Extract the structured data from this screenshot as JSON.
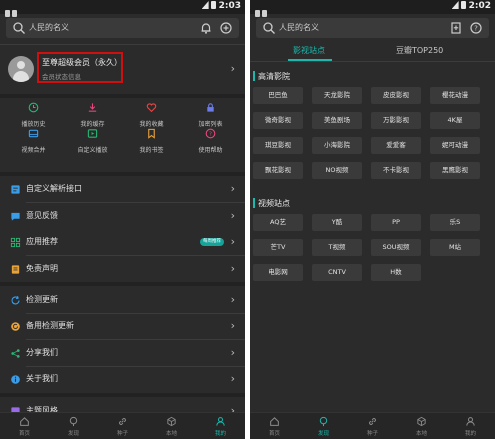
{
  "status": {
    "time": "2:03",
    "time_right": "2:02"
  },
  "left": {
    "search_placeholder": "人民的名义",
    "profile": {
      "title": "至尊超级会员（永久）",
      "subtitle": "会员状态信息"
    },
    "grid": [
      {
        "label": "播放历史",
        "icon": "clock-icon",
        "color": "#2bb673"
      },
      {
        "label": "我的缓存",
        "icon": "download-icon",
        "color": "#e8467a"
      },
      {
        "label": "我的收藏",
        "icon": "heart-icon",
        "color": "#e84646"
      },
      {
        "label": "加密列表",
        "icon": "lock-icon",
        "color": "#6b7be8"
      },
      {
        "label": "视频合并",
        "icon": "video-icon",
        "color": "#3a9de8"
      },
      {
        "label": "自定义播放",
        "icon": "play-box-icon",
        "color": "#2bb673"
      },
      {
        "label": "我的书签",
        "icon": "bookmark-icon",
        "color": "#e8a23a"
      },
      {
        "label": "使用帮助",
        "icon": "help-icon",
        "color": "#e8467a"
      }
    ],
    "menu": [
      {
        "label": "自定义解析接口",
        "icon": "api-icon",
        "color": "#3a9de8"
      },
      {
        "label": "意见反馈",
        "icon": "feedback-icon",
        "color": "#3a9de8"
      },
      {
        "label": "应用推荐",
        "icon": "apps-icon",
        "color": "#2bb673",
        "badge": "每周推荐"
      },
      {
        "label": "免责声明",
        "icon": "doc-icon",
        "color": "#e8a23a"
      },
      {
        "label": "检测更新",
        "icon": "refresh-icon",
        "color": "#3a9de8"
      },
      {
        "label": "备用检测更新",
        "icon": "refresh-alt-icon",
        "color": "#e8a23a"
      },
      {
        "label": "分享我们",
        "icon": "share-icon",
        "color": "#2bb673"
      },
      {
        "label": "关于我们",
        "icon": "info-icon",
        "color": "#3a9de8"
      },
      {
        "label": "主题风格",
        "icon": "theme-icon",
        "color": "#9a6be8"
      }
    ],
    "bottom_nav": [
      {
        "label": "首页",
        "icon": "home-icon"
      },
      {
        "label": "发现",
        "icon": "compass-icon"
      },
      {
        "label": "种子",
        "icon": "link-icon"
      },
      {
        "label": "本地",
        "icon": "cube-icon"
      },
      {
        "label": "我的",
        "icon": "person-icon",
        "active": true
      }
    ]
  },
  "right": {
    "search_placeholder": "人民的名义",
    "tabs": [
      {
        "label": "影视站点",
        "active": true
      },
      {
        "label": "豆瓣TOP250"
      }
    ],
    "sections": [
      {
        "title": "高清影院",
        "items": [
          "巴巴鱼",
          "天龙影院",
          "皮皮影视",
          "樱花动漫",
          "微奇影视",
          "美鱼剧场",
          "万影影视",
          "4K屋",
          "琪豆影视",
          "小海影院",
          "爱爱客",
          "妮可动漫",
          "飘花影视",
          "NO视频",
          "不卡影视",
          "黑鹰影视"
        ]
      },
      {
        "title": "视频站点",
        "items": [
          "AQ艺",
          "Y酷",
          "PP",
          "乐S",
          "芒TV",
          "T视频",
          "SOU视频",
          "M站",
          "电影网",
          "CNTV",
          "H数"
        ]
      }
    ],
    "bottom_nav": [
      {
        "label": "首页",
        "icon": "home-icon"
      },
      {
        "label": "发现",
        "icon": "compass-icon",
        "active": true
      },
      {
        "label": "种子",
        "icon": "link-icon"
      },
      {
        "label": "本地",
        "icon": "cube-icon"
      },
      {
        "label": "我的",
        "icon": "person-icon"
      }
    ]
  }
}
